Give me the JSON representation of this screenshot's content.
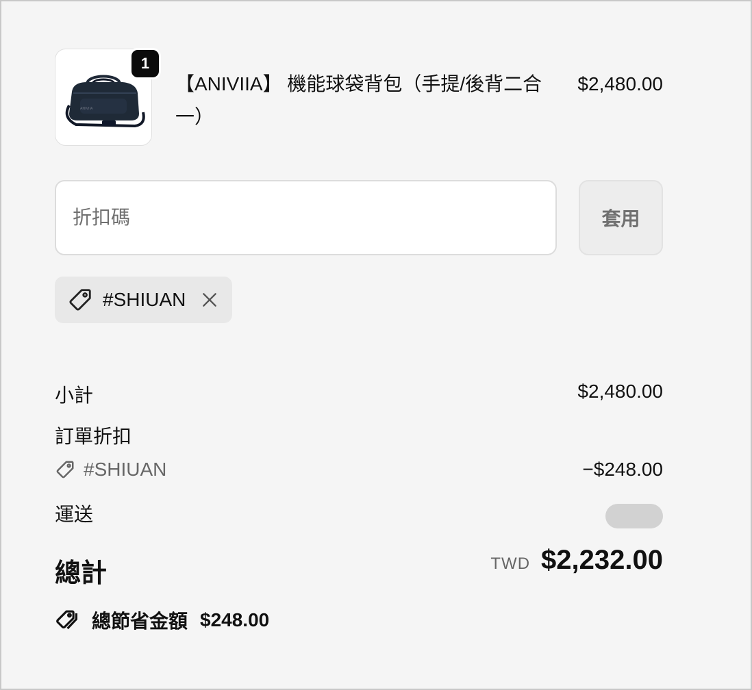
{
  "product": {
    "title": "【ANIVIIA】 機能球袋背包（手提/後背二合一）",
    "price": "$2,480.00",
    "quantity": "1",
    "image_icon": "duffel-bag-icon"
  },
  "discount": {
    "placeholder": "折扣碼",
    "value": "",
    "apply_label": "套用",
    "applied_code": "#SHIUAN"
  },
  "summary": {
    "subtotal_label": "小計",
    "subtotal_value": "$2,480.00",
    "order_discount_label": "訂單折扣",
    "discount_code": "#SHIUAN",
    "discount_value": "−$248.00",
    "shipping_label": "運送",
    "total_label": "總計",
    "currency": "TWD",
    "total_value": "$2,232.00",
    "savings_label": "總節省金額",
    "savings_value": "$248.00"
  },
  "colors": {
    "background": "#f5f5f5",
    "badge": "#0b0b0b",
    "muted_text": "#707070"
  }
}
